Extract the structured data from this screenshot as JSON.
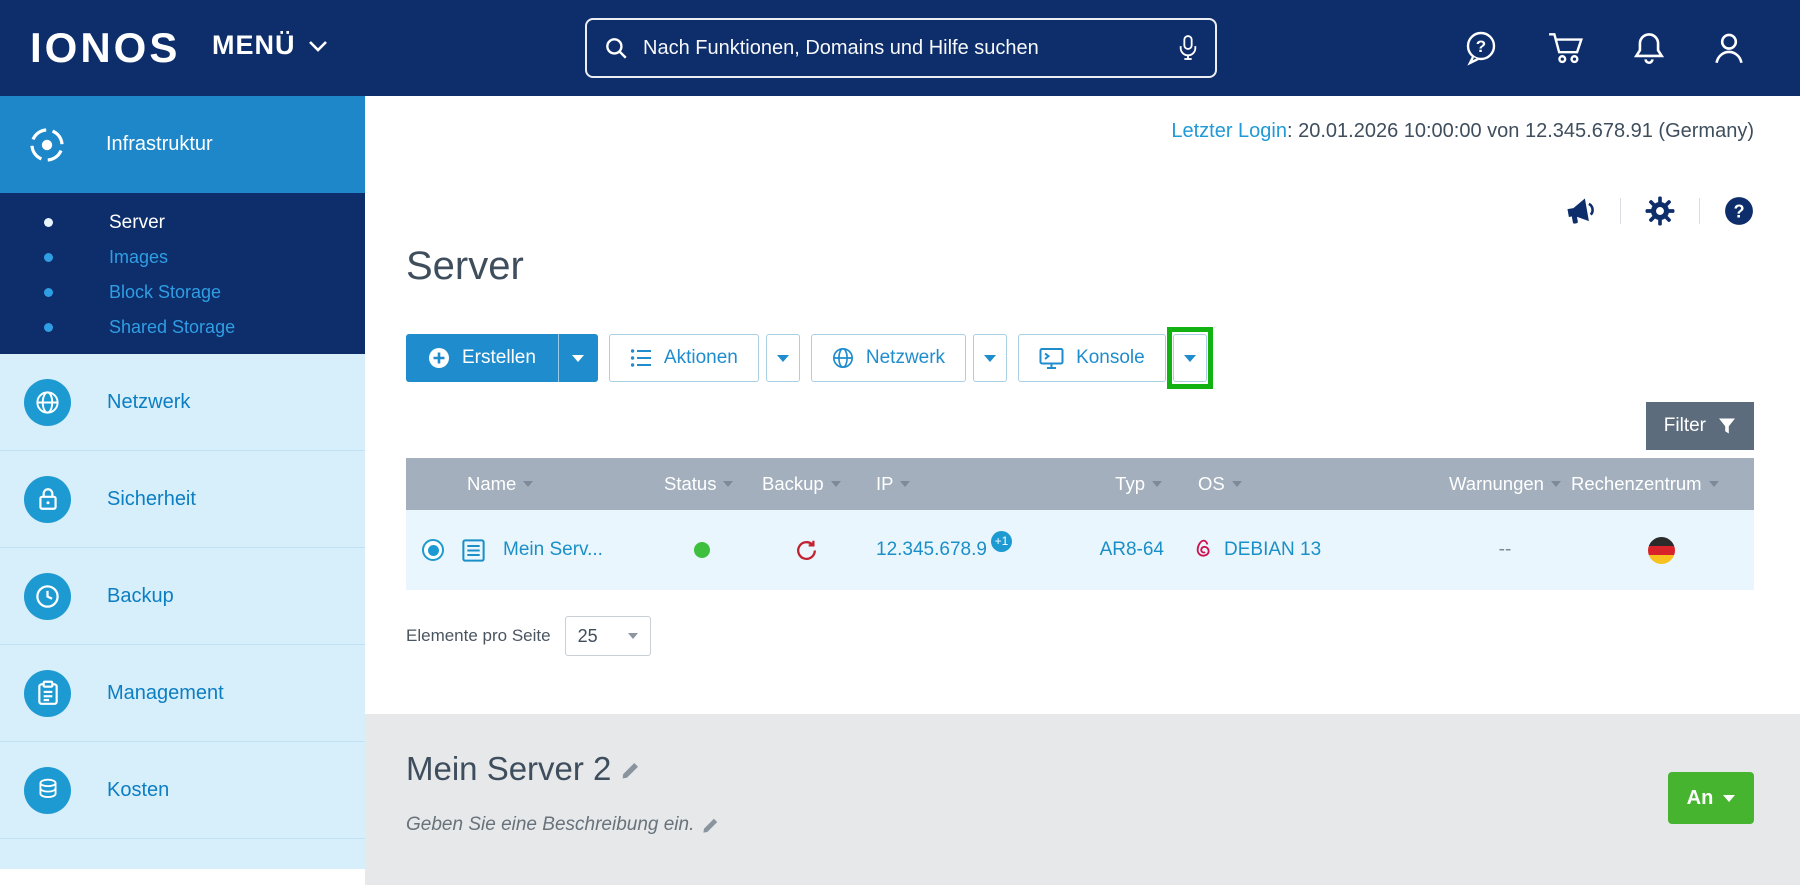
{
  "colors": {
    "header_bg": "#0d2d6b",
    "brand_blue": "#1f8dcd",
    "sidebar_active_bg": "#1d87c9",
    "sidebar_bg": "#d7eefb",
    "table_header_bg": "#a3afbd",
    "filter_bg": "#5c6c7c",
    "row_bg": "#e9f6fd",
    "status_green": "#3ec03e",
    "power_green": "#46b42e",
    "annotation_green": "#12b212",
    "detail_bg": "#e6e8ea"
  },
  "header": {
    "logo": "IONOS",
    "menu": "MENÜ",
    "search_placeholder": "Nach Funktionen, Domains und Hilfe suchen"
  },
  "sidebar": {
    "active": {
      "label": "Infrastruktur"
    },
    "submenu": [
      {
        "label": "Server"
      },
      {
        "label": "Images"
      },
      {
        "label": "Block Storage"
      },
      {
        "label": "Shared Storage"
      }
    ],
    "items": [
      {
        "label": "Netzwerk"
      },
      {
        "label": "Sicherheit"
      },
      {
        "label": "Backup"
      },
      {
        "label": "Management"
      },
      {
        "label": "Kosten"
      }
    ]
  },
  "main": {
    "last_login_label": "Letzter Login",
    "last_login_value": ": 20.01.2026 10:00:00 von 12.345.678.91 (Germany)",
    "title": "Server",
    "toolbar": {
      "create": "Erstellen",
      "actions": "Aktionen",
      "network": "Netzwerk",
      "console": "Konsole"
    },
    "filter": "Filter",
    "table": {
      "columns": [
        "Name",
        "Status",
        "Backup",
        "IP",
        "Typ",
        "OS",
        "Warnungen",
        "Rechenzentrum"
      ],
      "row": {
        "name": "Mein Serv...",
        "ip": "12.345.678.9",
        "ip_badge": "+1",
        "typ": "AR8-64",
        "os": "DEBIAN 13",
        "warnings": "--",
        "datacenter_flag": "german-flag"
      }
    },
    "pagination": {
      "label": "Elemente pro Seite",
      "value": "25"
    }
  },
  "detail": {
    "title": "Mein Server 2",
    "description": "Geben Sie eine Beschreibung ein.",
    "power": "An"
  }
}
